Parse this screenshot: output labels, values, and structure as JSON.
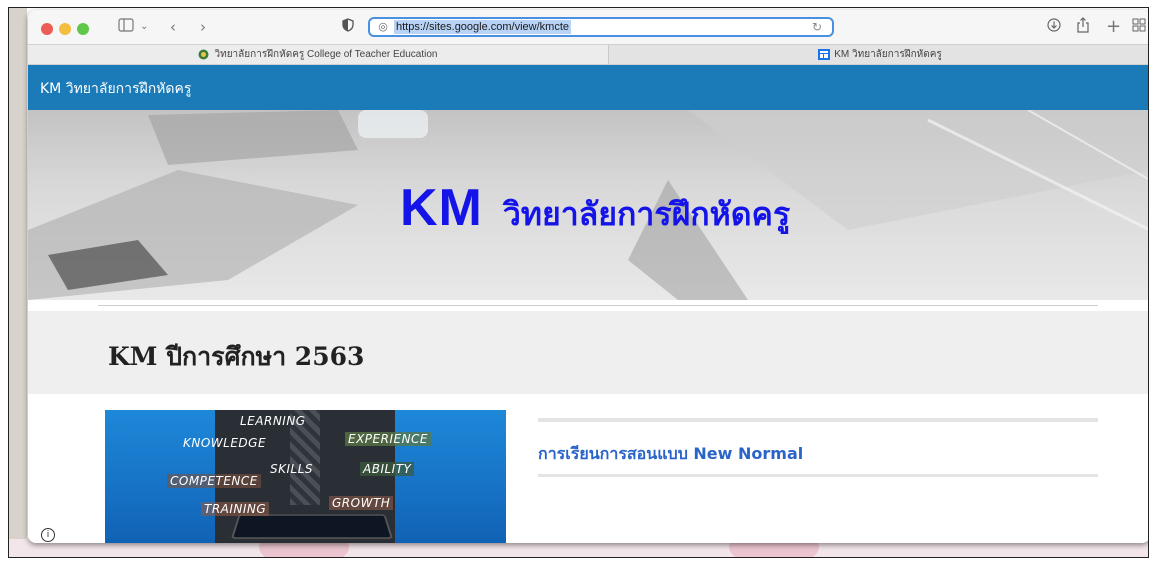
{
  "browser": {
    "url": "https://sites.google.com/view/kmcte",
    "tabs": [
      {
        "label": "วิทยาลัยการฝึกหัดครู College of Teacher Education",
        "active": true
      },
      {
        "label": "KM วิทยาลัยการฝึกหัดครู",
        "active": false
      }
    ],
    "icons": {
      "sidebar": "sidebar-icon",
      "back": "back-icon",
      "forward": "forward-icon",
      "shield": "privacy-shield-icon",
      "reload": "reload-icon",
      "download": "download-icon",
      "share": "share-icon",
      "new_tab": "plus-icon",
      "tab_overview": "grid-icon"
    }
  },
  "site": {
    "header_title": "KM วิทยาลัยการฝึกหัดครู",
    "hero_km": "KM",
    "hero_subtitle": "วิทยาลัยการฝึกหัดครู",
    "section_title": "KM ปีการศึกษา 2563",
    "card_title": "การเรียนการสอนแบบ New Normal",
    "thumbnail_words": [
      "LEARNING",
      "KNOWLEDGE",
      "EXPERIENCE",
      "SKILLS",
      "ABILITY",
      "COMPETENCE",
      "TRAINING",
      "GROWTH"
    ],
    "info_icon": "info-icon"
  },
  "colors": {
    "site_header": "#1a7bb8",
    "hero_title": "#1414e8",
    "card_title": "#2b64c8",
    "address_focus": "#4a90e2"
  }
}
